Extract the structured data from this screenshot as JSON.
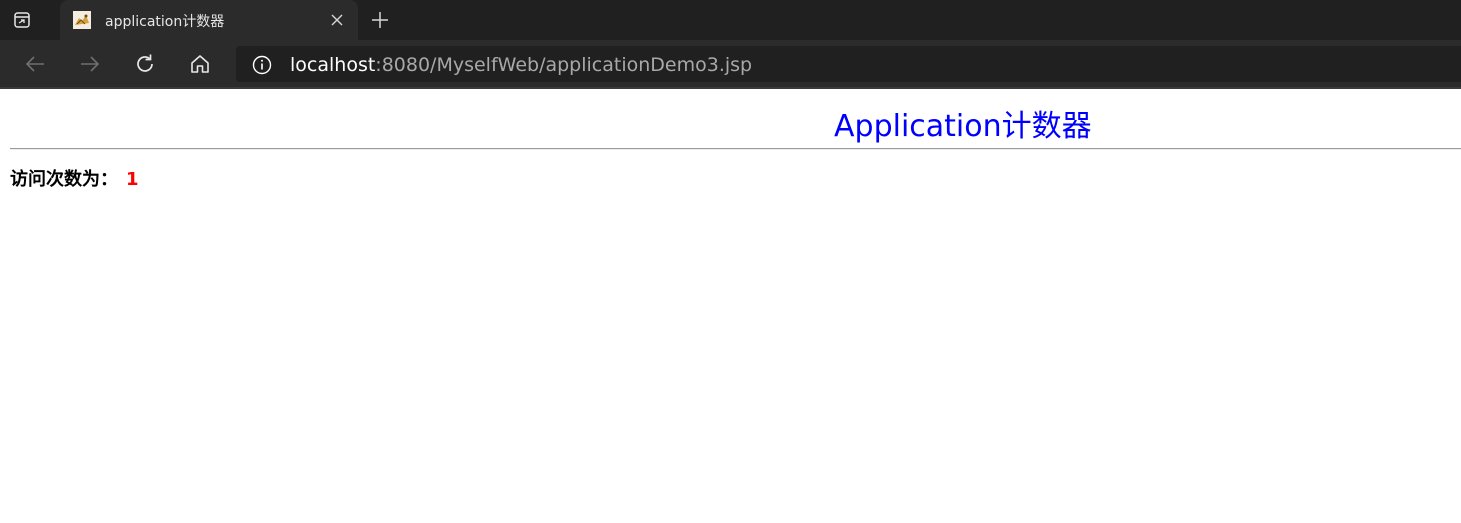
{
  "browser": {
    "tab": {
      "title": "application计数器",
      "favicon": "tomcat-icon"
    },
    "toolbar": {
      "back_icon": "back-arrow-icon",
      "forward_icon": "forward-arrow-icon",
      "refresh_icon": "refresh-icon",
      "home_icon": "home-icon"
    },
    "address": {
      "host": "localhost",
      "path": ":8080/MyselfWeb/applicationDemo3.jsp",
      "security_icon": "info-icon"
    },
    "colors": {
      "tabstrip": "#202020",
      "toolbar": "#2b2b2b",
      "addressbar": "#202020"
    }
  },
  "page": {
    "heading": "Application计数器",
    "visit_label": "访问次数为：",
    "visit_count": "1",
    "colors": {
      "heading": "#0000ff",
      "count": "#ff0000"
    }
  }
}
